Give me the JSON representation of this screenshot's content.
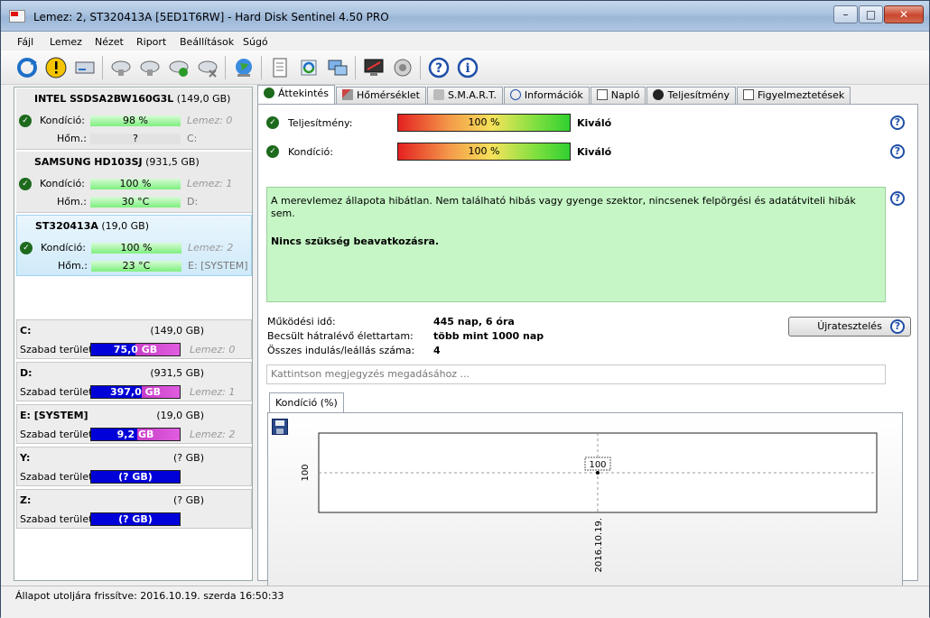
{
  "window": {
    "title": "Lemez: 2, ST320413A [5ED1T6RW]  -  Hard Disk Sentinel 4.50 PRO",
    "min": "–",
    "max": "□",
    "close": "✕"
  },
  "menu": [
    "Fájl",
    "Lemez",
    "Nézet",
    "Riport",
    "Beállítások",
    "Súgó"
  ],
  "disks": [
    {
      "model": "INTEL SSDSA2BW160G3L",
      "size": "(149,0 GB)",
      "kondicio_label": "Kondíció:",
      "kondicio": "98 %",
      "hom_label": "Hőm.:",
      "hom": "?",
      "lemez": "Lemez: 0",
      "drive": "C:",
      "kondicio_pct": 98
    },
    {
      "model": "SAMSUNG HD103SJ",
      "size": "(931,5 GB)",
      "kondicio_label": "Kondíció:",
      "kondicio": "100 %",
      "hom_label": "Hőm.:",
      "hom": "30 °C",
      "lemez": "Lemez: 1",
      "drive": "D:",
      "kondicio_pct": 100
    },
    {
      "model": "ST320413A",
      "size": "(19,0 GB)",
      "kondicio_label": "Kondíció:",
      "kondicio": "100 %",
      "hom_label": "Hőm.:",
      "hom": "23 °C",
      "lemez": "Lemez: 2",
      "drive": "E: [SYSTEM]",
      "kondicio_pct": 100
    }
  ],
  "partitions": [
    {
      "name": "C:",
      "size": "(149,0 GB)",
      "free_label": "Szabad terület",
      "free": "75,0 GB",
      "lemez": "Lemez: 0",
      "used_pct": 0.5
    },
    {
      "name": "D:",
      "size": "(931,5 GB)",
      "free_label": "Szabad terület",
      "free": "397,0 GB",
      "lemez": "Lemez: 1",
      "used_pct": 0.57
    },
    {
      "name": "E: [SYSTEM]",
      "size": "(19,0 GB)",
      "free_label": "Szabad terület",
      "free": "9,2 GB",
      "lemez": "Lemez: 2",
      "used_pct": 0.52
    },
    {
      "name": "Y:",
      "size": "(? GB)",
      "free_label": "Szabad terület",
      "free": "(? GB)",
      "lemez": "",
      "used_pct": 0
    },
    {
      "name": "Z:",
      "size": "(? GB)",
      "free_label": "Szabad terület",
      "free": "(? GB)",
      "lemez": "",
      "used_pct": 0
    }
  ],
  "tabs": [
    "Áttekintés",
    "Hőmérséklet",
    "S.M.A.R.T.",
    "Információk",
    "Napló",
    "Teljesítmény",
    "Figyelmeztetések"
  ],
  "overview": {
    "perf_label": "Teljesítmény:",
    "perf_value": "100 %",
    "perf_rating": "Kiváló",
    "health_label": "Kondíció:",
    "health_value": "100 %",
    "health_rating": "Kiváló",
    "message": "A merevlemez állapota hibátlan. Nem található hibás vagy gyenge szektor, nincsenek felpörgési és adatátviteli hibák sem.",
    "message_bold": "Nincs szükség beavatkozásra.",
    "uptime_label": "Működési idő:",
    "uptime": "445 nap, 6 óra",
    "remaining_label": "Becsült hátralévő élettartam:",
    "remaining": "több mint 1000 nap",
    "startstop_label": "Összes indulás/leállás száma:",
    "startstop": "4",
    "retest_button": "Újratesztelés",
    "note_placeholder": "Kattintson megjegyzés megadásához ...",
    "chart_tab": "Kondíció  (%)"
  },
  "chart_data": {
    "type": "line",
    "x": [
      "2016.10.19."
    ],
    "series": [
      {
        "values": [
          100
        ]
      }
    ],
    "ylabel": "",
    "ytick": "100",
    "xtick": "2016.10.19.",
    "point_label": "100"
  },
  "statusbar": {
    "text": "Állapot utoljára frissítve: 2016.10.19. szerda 16:50:33"
  }
}
